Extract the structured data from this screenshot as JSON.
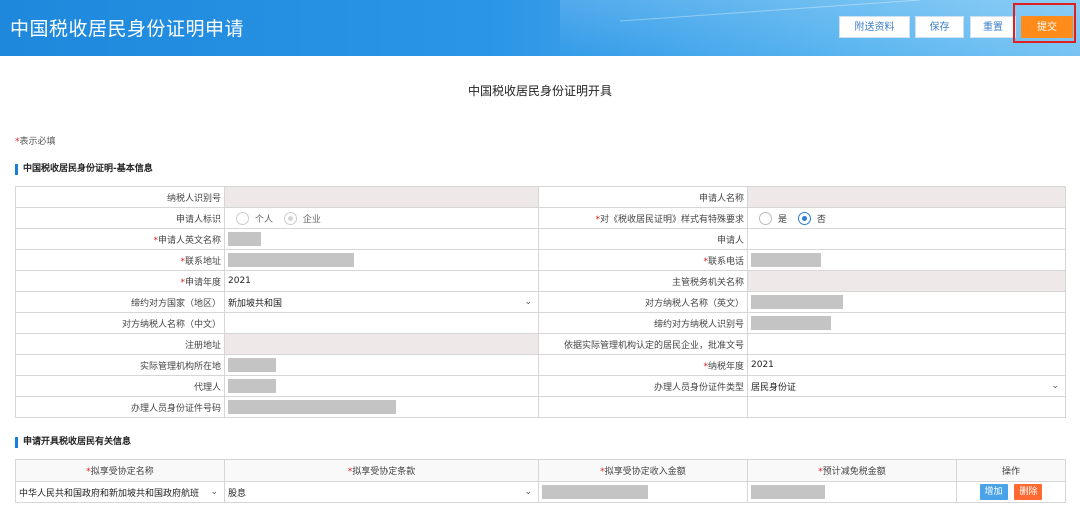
{
  "header": {
    "title": "中国税收居民身份证明申请",
    "buttons": {
      "attach": "附送资料",
      "save": "保存",
      "reset": "重置",
      "submit": "提交"
    }
  },
  "page_title": "中国税收居民身份证明开具",
  "required_note": {
    "star": "*",
    "text": "表示必填"
  },
  "section1": {
    "title": "中国税收居民身份证明-基本信息",
    "rows": {
      "taxpayer_id": "纳税人识别号",
      "applicant_name": "申请人名称",
      "applicant_flag": "申请人标识",
      "opt_person": "个人",
      "opt_company": "企业",
      "special_req": "对《税收居民证明》样式有特殊要求",
      "opt_yes": "是",
      "opt_no": "否",
      "applicant_en": "申请人英文名称",
      "applicant": "申请人",
      "address": "联系地址",
      "phone": "联系电话",
      "apply_year": "申请年度",
      "apply_year_value": "2021",
      "tax_authority": "主管税务机关名称",
      "treaty_country": "缔约对方国家（地区）",
      "treaty_country_value": "新加坡共和国",
      "counter_name_en": "对方纳税人名称（英文）",
      "counter_name_cn": "对方纳税人名称（中文）",
      "counter_tax_id": "缔约对方纳税人识别号",
      "reg_address": "注册地址",
      "resident_doc": "依据实际管理机构认定的居民企业，批准文号",
      "mgmt_location": "实际管理机构所在地",
      "tax_year": "纳税年度",
      "tax_year_value": "2021",
      "agent": "代理人",
      "handler_id_type": "办理人员身份证件类型",
      "handler_id_type_value": "居民身份证",
      "handler_id_no": "办理人员身份证件号码"
    }
  },
  "section2": {
    "title": "申请开具税收居民有关信息",
    "headers": [
      "拟享受协定名称",
      "拟享受协定条款",
      "拟享受协定收入金额",
      "预计减免税金额",
      "操作"
    ],
    "row": {
      "treaty_name": "中华人民共和国政府和新加坡共和国政府航班",
      "treaty_clause": "股息",
      "add": "增加",
      "delete": "删除"
    }
  },
  "colors": {
    "header_blue": "#1e88dc",
    "submit_orange": "#ff8c1a",
    "highlight_red": "#e02020",
    "add_blue": "#4aa3e8",
    "delete_red": "#ff6a33"
  }
}
